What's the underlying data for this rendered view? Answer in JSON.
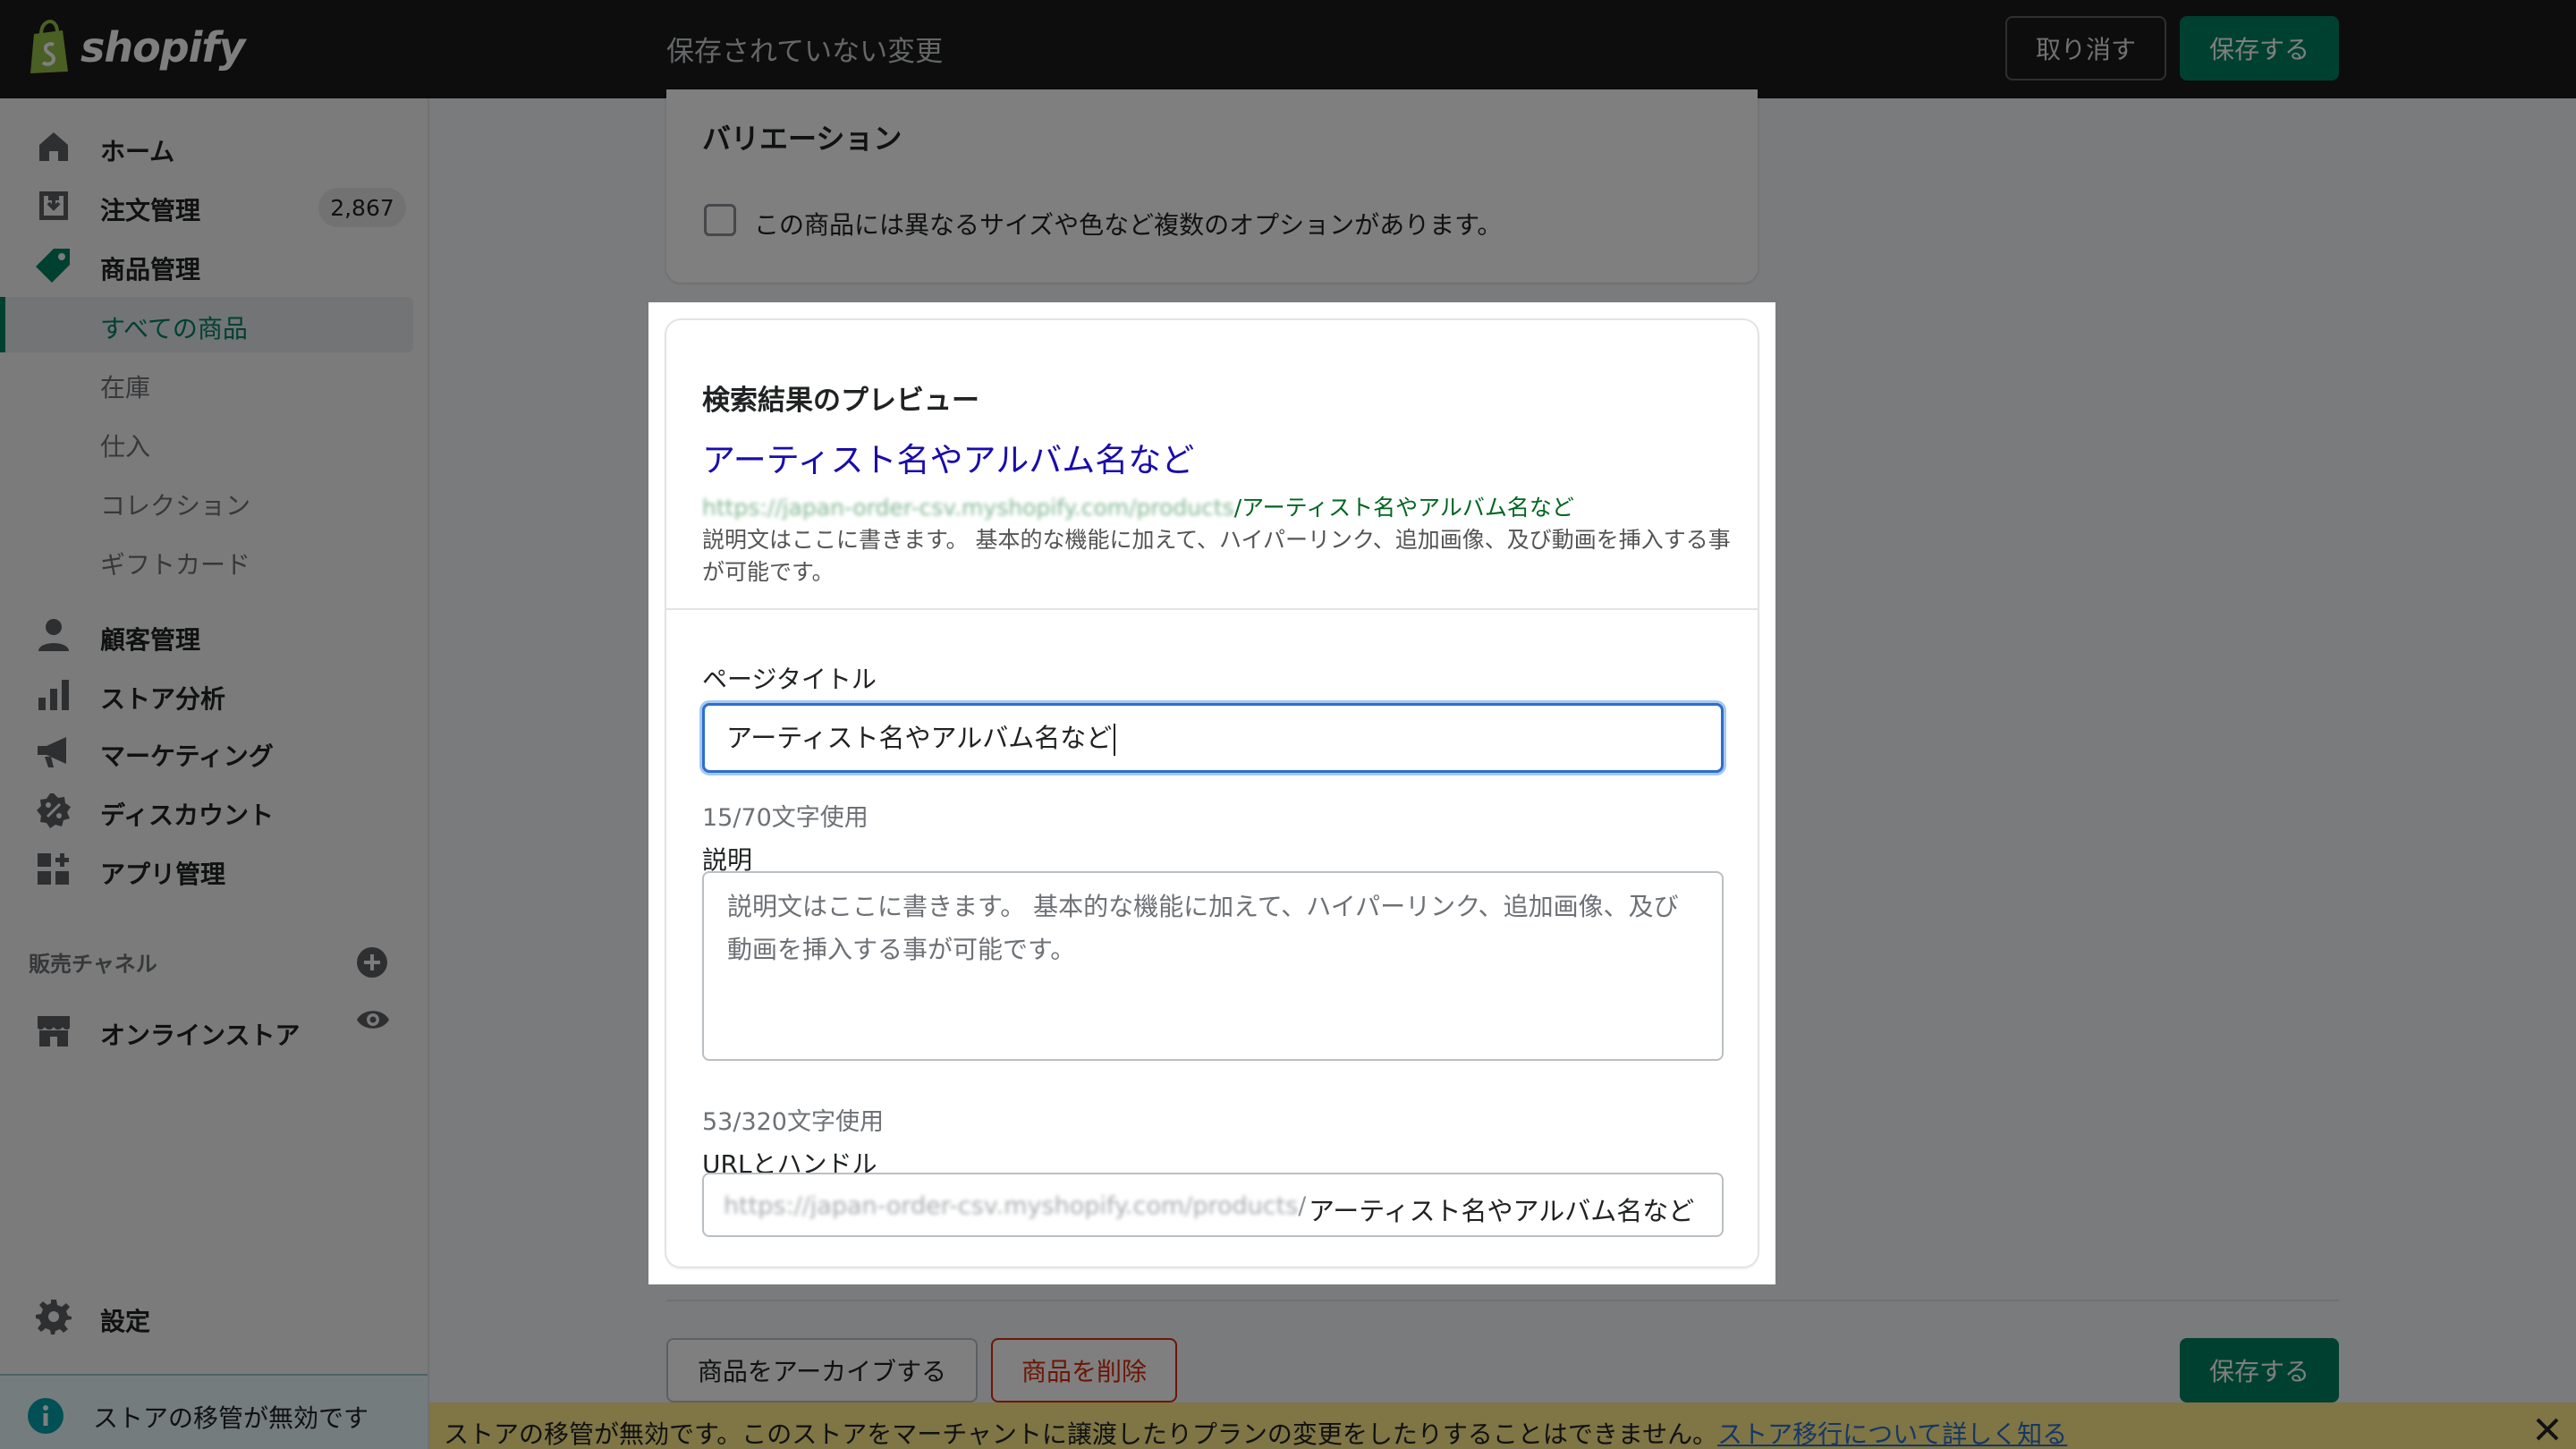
{
  "topbar": {
    "logo_text": "shopify",
    "unsaved_text": "保存されていない変更",
    "discard_label": "取り消す",
    "save_label": "保存する"
  },
  "sidebar": {
    "items": [
      {
        "label": "ホーム",
        "icon": "home-icon"
      },
      {
        "label": "注文管理",
        "icon": "orders-icon",
        "badge": "2,867"
      },
      {
        "label": "商品管理",
        "icon": "tag-icon"
      },
      {
        "label": "顧客管理",
        "icon": "person-icon"
      },
      {
        "label": "ストア分析",
        "icon": "analytics-icon"
      },
      {
        "label": "マーケティング",
        "icon": "megaphone-icon"
      },
      {
        "label": "ディスカウント",
        "icon": "discount-icon"
      },
      {
        "label": "アプリ管理",
        "icon": "apps-icon"
      }
    ],
    "product_subitems": [
      {
        "label": "すべての商品",
        "selected": true
      },
      {
        "label": "在庫"
      },
      {
        "label": "仕入"
      },
      {
        "label": "コレクション"
      },
      {
        "label": "ギフトカード"
      }
    ],
    "sales_channels_title": "販売チャネル",
    "online_store_label": "オンラインストア",
    "settings_label": "設定",
    "store_notice": "ストアの移管が無効です"
  },
  "variations": {
    "title": "バリエーション",
    "checkbox_label": "この商品には異なるサイズや色など複数のオプションがあります。",
    "checked": false
  },
  "modal": {
    "title": "検索結果のプレビュー",
    "preview_title": "アーティスト名やアルバム名など",
    "preview_url_base": "https://japan-order-csv.myshopify.com/products",
    "preview_url_handle": "/アーティスト名やアルバム名など",
    "preview_description": "説明文はここに書きます。 基本的な機能に加えて、ハイパーリンク、追加画像、及び動画を挿入する事が可能です。",
    "page_title_label": "ページタイトル",
    "page_title_value": "アーティスト名やアルバム名など",
    "page_title_count": "15/70文字使用",
    "description_label": "説明",
    "description_value": "説明文はここに書きます。 基本的な機能に加えて、ハイパーリンク、追加画像、及び動画を挿入する事が可能です。",
    "description_count": "53/320文字使用",
    "url_label": "URLとハンドル",
    "url_prefix": "https://japan-order-csv.myshopify.com/products",
    "url_separator": "/",
    "url_handle": "アーティスト名やアルバム名など"
  },
  "footer": {
    "archive_label": "商品をアーカイブする",
    "delete_label": "商品を削除",
    "save_label": "保存する"
  },
  "warning": {
    "text": "ストアの移管が無効です。このストアをマーチャントに譲渡したりプランの変更をしたりすることはできません。",
    "link": "ストア移行について詳しく知る"
  },
  "colors": {
    "primary": "#008060",
    "topbar": "#1a1a1a",
    "critical": "#d82c0d",
    "focus": "#2c6ecb",
    "warning_bg": "#ffea8a",
    "preview_link": "#1a0dab",
    "preview_url": "#006621"
  }
}
